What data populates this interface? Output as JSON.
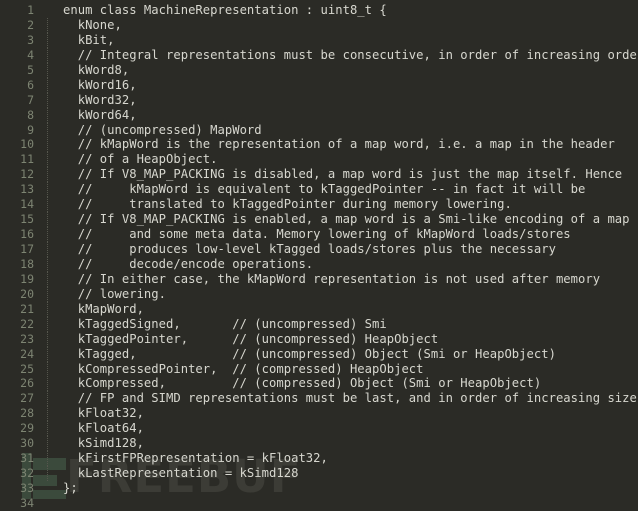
{
  "editor": {
    "language": "cpp",
    "background_color": "#2b2b26",
    "text_color": "#d7d7cf",
    "line_number_color": "#7d8472",
    "indent_guide_color": "#55564d",
    "first_line_number": 1,
    "last_line_number": 34,
    "total_lines": 34
  },
  "watermark": {
    "text": "FREEBUF",
    "text_color": "#3c3c36",
    "mark_color": "#3b4a3c",
    "mark_name": "freebuf-logo-mark"
  },
  "code_lines": [
    {
      "number": "1",
      "text": "enum class MachineRepresentation : uint8_t {",
      "guide": false
    },
    {
      "number": "2",
      "text": "  kNone,",
      "guide": true
    },
    {
      "number": "3",
      "text": "  kBit,",
      "guide": true
    },
    {
      "number": "4",
      "text": "  // Integral representations must be consecutive, in order of increasing order.",
      "guide": true
    },
    {
      "number": "5",
      "text": "  kWord8,",
      "guide": true
    },
    {
      "number": "6",
      "text": "  kWord16,",
      "guide": true
    },
    {
      "number": "7",
      "text": "  kWord32,",
      "guide": true
    },
    {
      "number": "8",
      "text": "  kWord64,",
      "guide": true
    },
    {
      "number": "9",
      "text": "  // (uncompressed) MapWord",
      "guide": true
    },
    {
      "number": "10",
      "text": "  // kMapWord is the representation of a map word, i.e. a map in the header",
      "guide": true
    },
    {
      "number": "11",
      "text": "  // of a HeapObject.",
      "guide": true
    },
    {
      "number": "12",
      "text": "  // If V8_MAP_PACKING is disabled, a map word is just the map itself. Hence",
      "guide": true
    },
    {
      "number": "13",
      "text": "  //     kMapWord is equivalent to kTaggedPointer -- in fact it will be",
      "guide": true
    },
    {
      "number": "14",
      "text": "  //     translated to kTaggedPointer during memory lowering.",
      "guide": true
    },
    {
      "number": "15",
      "text": "  // If V8_MAP_PACKING is enabled, a map word is a Smi-like encoding of a map",
      "guide": true
    },
    {
      "number": "16",
      "text": "  //     and some meta data. Memory lowering of kMapWord loads/stores",
      "guide": true
    },
    {
      "number": "17",
      "text": "  //     produces low-level kTagged loads/stores plus the necessary",
      "guide": true
    },
    {
      "number": "18",
      "text": "  //     decode/encode operations.",
      "guide": true
    },
    {
      "number": "19",
      "text": "  // In either case, the kMapWord representation is not used after memory",
      "guide": true
    },
    {
      "number": "20",
      "text": "  // lowering.",
      "guide": true
    },
    {
      "number": "21",
      "text": "  kMapWord,",
      "guide": true
    },
    {
      "number": "22",
      "text": "  kTaggedSigned,       // (uncompressed) Smi",
      "guide": true
    },
    {
      "number": "23",
      "text": "  kTaggedPointer,      // (uncompressed) HeapObject",
      "guide": true
    },
    {
      "number": "24",
      "text": "  kTagged,             // (uncompressed) Object (Smi or HeapObject)",
      "guide": true
    },
    {
      "number": "25",
      "text": "  kCompressedPointer,  // (compressed) HeapObject",
      "guide": true
    },
    {
      "number": "26",
      "text": "  kCompressed,         // (compressed) Object (Smi or HeapObject)",
      "guide": true
    },
    {
      "number": "27",
      "text": "  // FP and SIMD representations must be last, and in order of increasing size.",
      "guide": true
    },
    {
      "number": "28",
      "text": "  kFloat32,",
      "guide": true
    },
    {
      "number": "29",
      "text": "  kFloat64,",
      "guide": true
    },
    {
      "number": "30",
      "text": "  kSimd128,",
      "guide": true
    },
    {
      "number": "31",
      "text": "  kFirstFPRepresentation = kFloat32,",
      "guide": true
    },
    {
      "number": "32",
      "text": "  kLastRepresentation = kSimd128",
      "guide": true
    },
    {
      "number": "33",
      "text": "};",
      "guide": false
    },
    {
      "number": "34",
      "text": "",
      "guide": false
    }
  ]
}
